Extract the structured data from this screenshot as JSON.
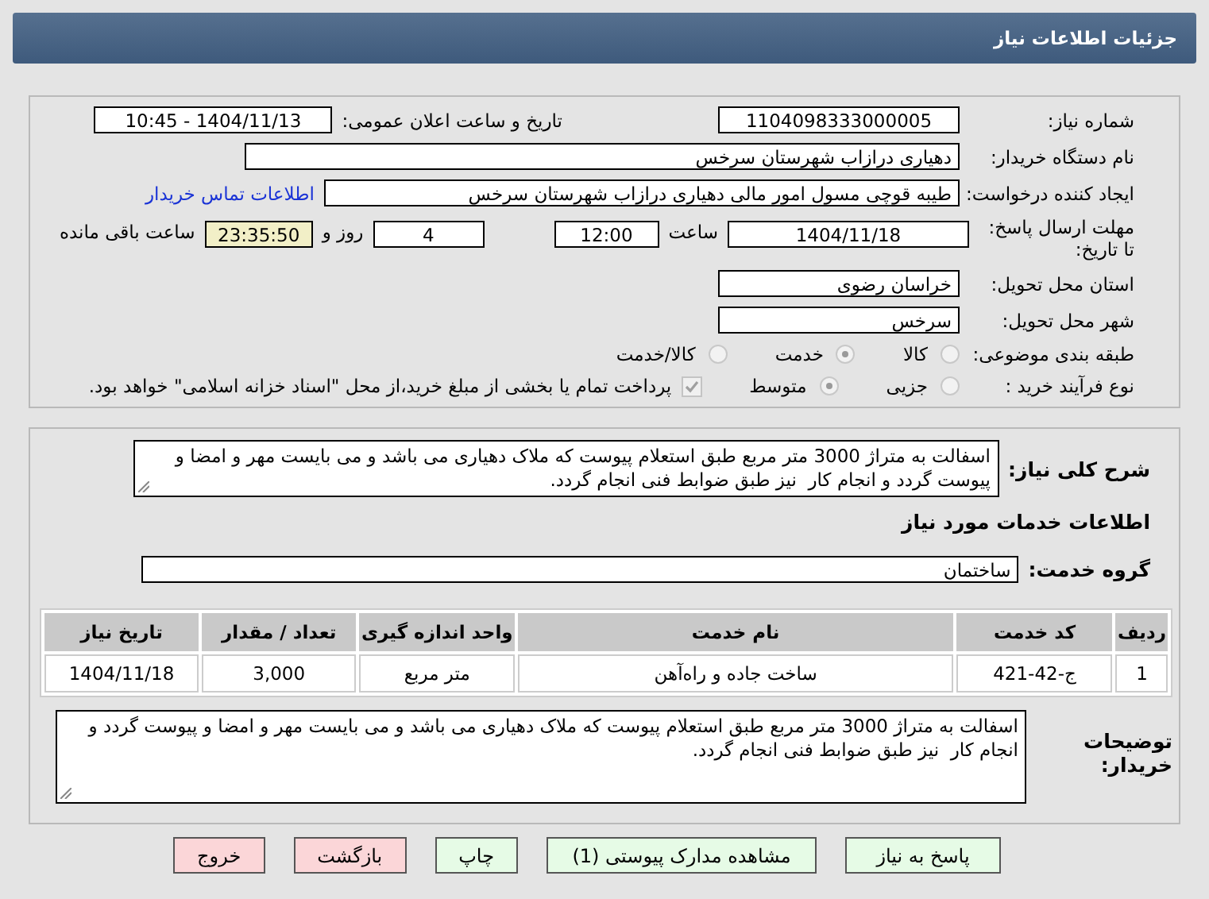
{
  "header": {
    "title": "جزئیات اطلاعات نیاز"
  },
  "need_number": {
    "label": "شماره نیاز:",
    "value": "1104098333000005"
  },
  "announce": {
    "label": "تاریخ و ساعت اعلان عمومی:",
    "value": "1404/11/13 - 10:45"
  },
  "buyer_org": {
    "label": "نام دستگاه خریدار:",
    "value": "دهیاری درازاب شهرستان سرخس"
  },
  "requester": {
    "label": "ایجاد کننده درخواست:",
    "value": "طیبه قوچی مسول امور مالی دهیاری درازاب شهرستان سرخس",
    "link": "اطلاعات تماس خریدار"
  },
  "deadline": {
    "label": "مهلت ارسال پاسخ: تا تاریخ:",
    "date": "1404/11/18",
    "time_label": "ساعت",
    "time": "12:00",
    "days": "4",
    "days_label": "روز و",
    "remaining": "23:35:50",
    "remaining_label": "ساعت باقی مانده"
  },
  "province": {
    "label": "استان محل تحویل:",
    "value": "خراسان رضوی"
  },
  "city": {
    "label": "شهر محل تحویل:",
    "value": "سرخس"
  },
  "category": {
    "label": "طبقه بندی موضوعی:",
    "options": [
      {
        "label": "کالا",
        "selected": false
      },
      {
        "label": "خدمت",
        "selected": true
      },
      {
        "label": "کالا/خدمت",
        "selected": false
      }
    ]
  },
  "purchase_type": {
    "label": "نوع فرآیند خرید :",
    "options": [
      {
        "label": "جزیی",
        "selected": false
      },
      {
        "label": "متوسط",
        "selected": true
      }
    ],
    "payment": {
      "checked": true,
      "text": "پرداخت تمام یا بخشی از مبلغ خرید،از محل \"اسناد خزانه اسلامی\" خواهد بود."
    }
  },
  "description": {
    "label": "شرح کلی نیاز:",
    "value": "اسفالت به متراژ 3000 متر مربع طبق استعلام پیوست که ملاک دهیاری می باشد و می بایست مهر و امضا و پیوست گردد و انجام کار  نیز طبق ضوابط فنی انجام گردد."
  },
  "services": {
    "heading": "اطلاعات خدمات مورد نیاز",
    "group": {
      "label": "گروه خدمت:",
      "value": "ساختمان"
    },
    "table": {
      "columns": [
        "ردیف",
        "کد خدمت",
        "نام خدمت",
        "واحد اندازه گیری",
        "تعداد / مقدار",
        "تاریخ نیاز"
      ],
      "rows": [
        [
          "1",
          "ج-42-421",
          "ساخت جاده و راه‌آهن",
          "متر مربع",
          "3,000",
          "1404/11/18"
        ]
      ]
    }
  },
  "buyer_notes": {
    "label": "توضیحات خریدار:",
    "value": "اسفالت به متراژ 3000 متر مربع طبق استعلام پیوست که ملاک دهیاری می باشد و می بایست مهر و امضا و پیوست گردد و انجام کار  نیز طبق ضوابط فنی انجام گردد."
  },
  "buttons": [
    {
      "label": "پاسخ به نیاز",
      "kind": "action"
    },
    {
      "label": "مشاهده مدارک پیوستی (1)",
      "kind": "action"
    },
    {
      "label": "چاپ",
      "kind": "action"
    },
    {
      "label": "بازگشت",
      "kind": "exit"
    },
    {
      "label": "خروج",
      "kind": "exit"
    }
  ]
}
